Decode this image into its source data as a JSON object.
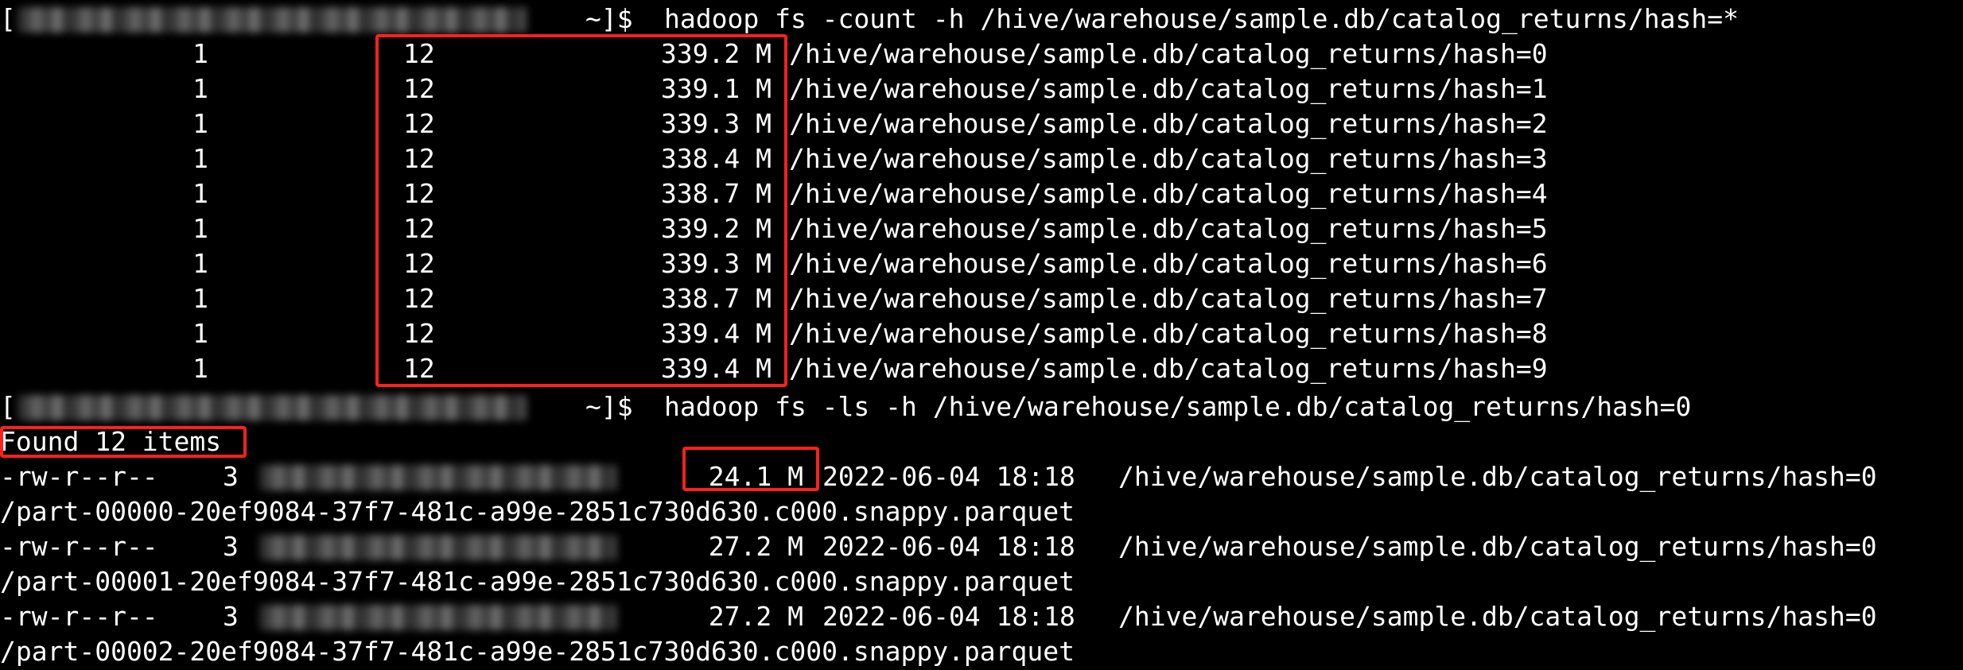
{
  "theme": {
    "background": "#000000",
    "foreground": "#ffffff",
    "highlight_box_color": "#ff2020"
  },
  "command_1": {
    "prompt_tail": "~]$",
    "command": "hadoop fs -count -h /hive/warehouse/sample.db/catalog_returns/hash=*"
  },
  "count_rows": [
    {
      "dir_count": "1",
      "file_count": "12",
      "content_size": "339.2 M",
      "path": "/hive/warehouse/sample.db/catalog_returns/hash=0"
    },
    {
      "dir_count": "1",
      "file_count": "12",
      "content_size": "339.1 M",
      "path": "/hive/warehouse/sample.db/catalog_returns/hash=1"
    },
    {
      "dir_count": "1",
      "file_count": "12",
      "content_size": "339.3 M",
      "path": "/hive/warehouse/sample.db/catalog_returns/hash=2"
    },
    {
      "dir_count": "1",
      "file_count": "12",
      "content_size": "338.4 M",
      "path": "/hive/warehouse/sample.db/catalog_returns/hash=3"
    },
    {
      "dir_count": "1",
      "file_count": "12",
      "content_size": "338.7 M",
      "path": "/hive/warehouse/sample.db/catalog_returns/hash=4"
    },
    {
      "dir_count": "1",
      "file_count": "12",
      "content_size": "339.2 M",
      "path": "/hive/warehouse/sample.db/catalog_returns/hash=5"
    },
    {
      "dir_count": "1",
      "file_count": "12",
      "content_size": "339.3 M",
      "path": "/hive/warehouse/sample.db/catalog_returns/hash=6"
    },
    {
      "dir_count": "1",
      "file_count": "12",
      "content_size": "338.7 M",
      "path": "/hive/warehouse/sample.db/catalog_returns/hash=7"
    },
    {
      "dir_count": "1",
      "file_count": "12",
      "content_size": "339.4 M",
      "path": "/hive/warehouse/sample.db/catalog_returns/hash=8"
    },
    {
      "dir_count": "1",
      "file_count": "12",
      "content_size": "339.4 M",
      "path": "/hive/warehouse/sample.db/catalog_returns/hash=9"
    }
  ],
  "command_2": {
    "prompt_tail": "~]$",
    "command": "hadoop fs -ls -h /hive/warehouse/sample.db/catalog_returns/hash=0"
  },
  "found_items": "Found 12 items",
  "ls_rows": [
    {
      "permissions": "-rw-r--r--",
      "replication": "3",
      "size": "24.1 M",
      "modified": "2022-06-04 18:18",
      "path": "/hive/warehouse/sample.db/catalog_returns/hash=0",
      "file": "/part-00000-20ef9084-37f7-481c-a99e-2851c730d630.c000.snappy.parquet"
    },
    {
      "permissions": "-rw-r--r--",
      "replication": "3",
      "size": "27.2 M",
      "modified": "2022-06-04 18:18",
      "path": "/hive/warehouse/sample.db/catalog_returns/hash=0",
      "file": "/part-00001-20ef9084-37f7-481c-a99e-2851c730d630.c000.snappy.parquet"
    },
    {
      "permissions": "-rw-r--r--",
      "replication": "3",
      "size": "27.2 M",
      "modified": "2022-06-04 18:18",
      "path": "/hive/warehouse/sample.db/catalog_returns/hash=0",
      "file": "/part-00002-20ef9084-37f7-481c-a99e-2851c730d630.c000.snappy.parquet"
    }
  ]
}
